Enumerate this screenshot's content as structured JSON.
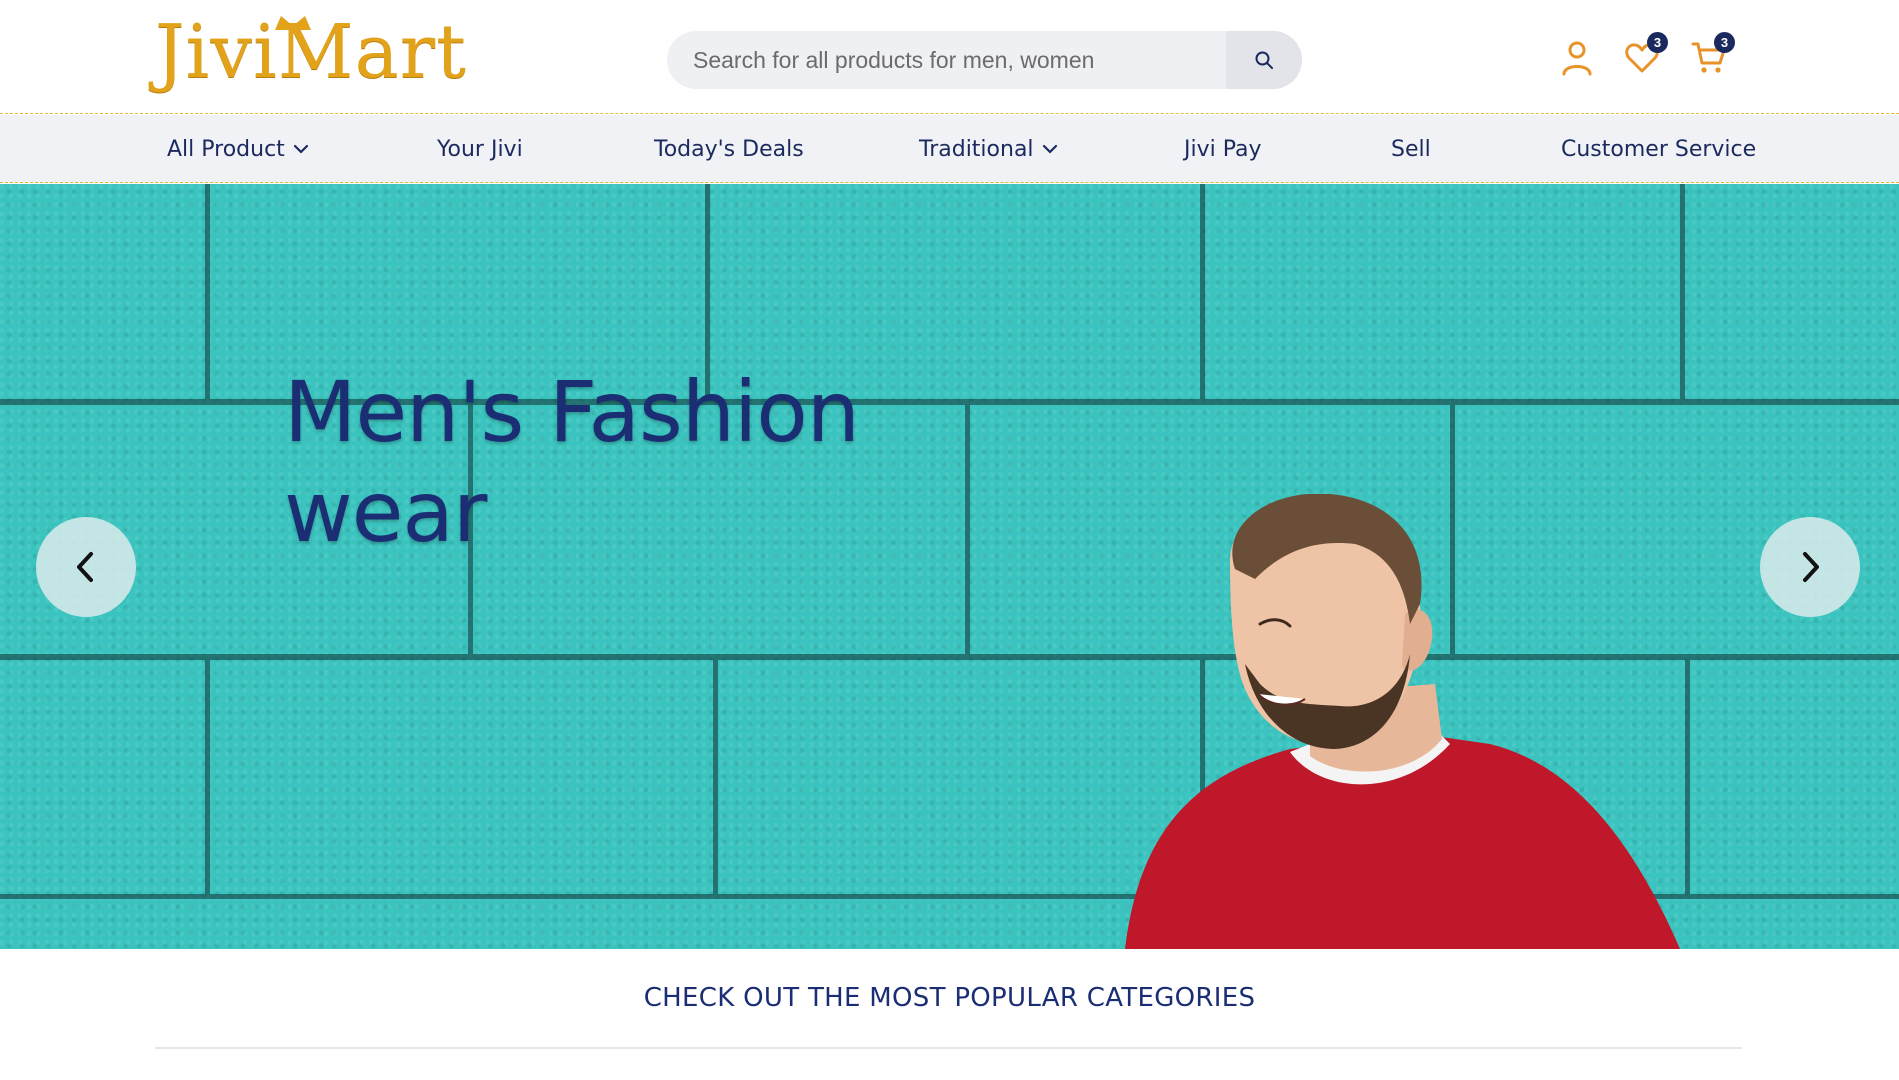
{
  "header": {
    "logo_text": "JiviMart",
    "search_placeholder": "Search for all products for men, women",
    "wishlist_count": "3",
    "cart_count": "3",
    "icons": [
      "user-icon",
      "heart-icon",
      "cart-icon",
      "search-icon"
    ]
  },
  "nav": {
    "items": [
      {
        "label": "All Product",
        "has_dropdown": true
      },
      {
        "label": "Your Jivi",
        "has_dropdown": false
      },
      {
        "label": "Today's Deals",
        "has_dropdown": false
      },
      {
        "label": "Traditional",
        "has_dropdown": true
      },
      {
        "label": "Jivi Pay",
        "has_dropdown": false
      },
      {
        "label": "Sell",
        "has_dropdown": false
      },
      {
        "label": "Customer Service",
        "has_dropdown": false
      }
    ]
  },
  "hero": {
    "title_line1": "Men's Fashion",
    "title_line2": "wear",
    "prev_icon": "chevron-left-icon",
    "next_icon": "chevron-right-icon"
  },
  "section": {
    "title": "CHECK OUT THE MOST POPULAR CATEGORIES"
  },
  "colors": {
    "brand_gold": "#e2a31b",
    "navy": "#1b2a5e",
    "hero_teal": "#3bc4bf",
    "sweater_red": "#c0182b"
  }
}
